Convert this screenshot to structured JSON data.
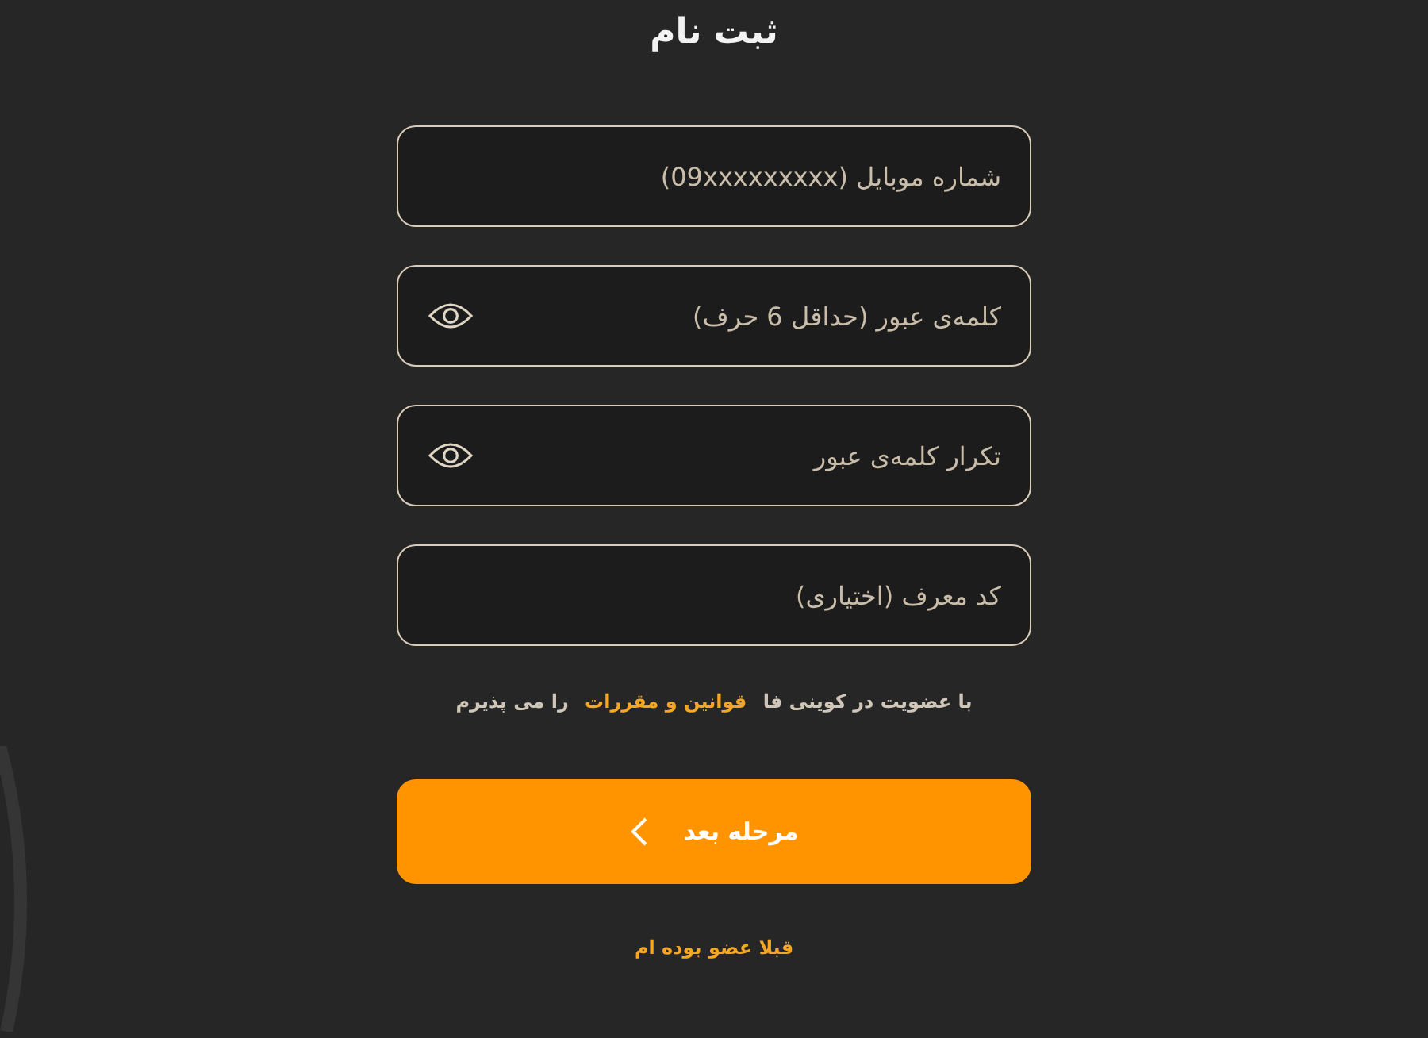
{
  "title": "ثبت نام",
  "fields": [
    {
      "kind": "text",
      "placeholder": "شماره موبایل (09xxxxxxxxx)"
    },
    {
      "kind": "password",
      "placeholder": "کلمه‌ی عبور (حداقل 6 حرف)"
    },
    {
      "kind": "password",
      "placeholder": "تکرار کلمه‌ی عبور"
    },
    {
      "kind": "text",
      "placeholder": "کد معرف (اختیاری)"
    }
  ],
  "terms": {
    "before": "با عضویت در کوینی فا",
    "link": "قوانین و مقررات",
    "after": "را می پذیرم"
  },
  "next_button": {
    "label": "مرحله بعد"
  },
  "login_link": "قبلا عضو بوده ام"
}
